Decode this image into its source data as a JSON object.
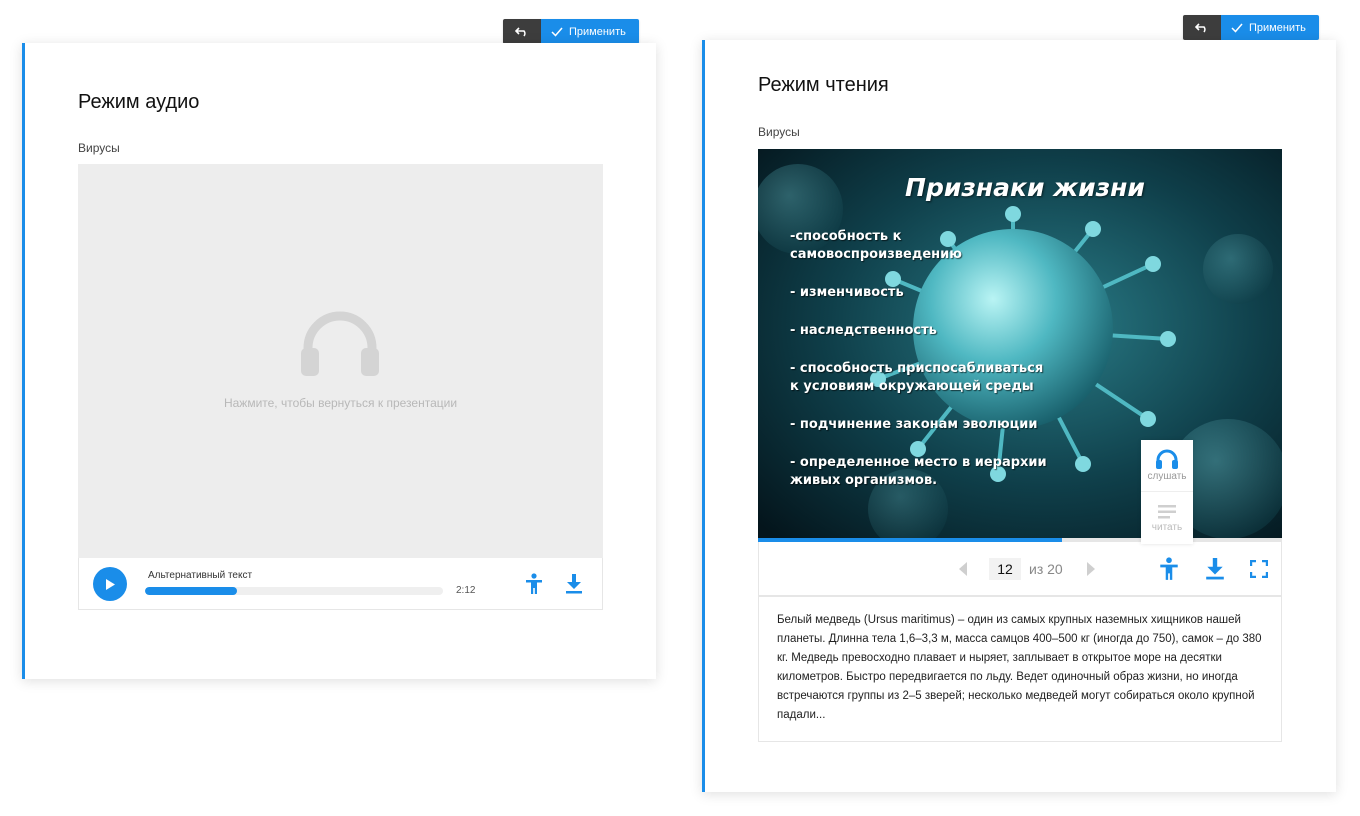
{
  "audio_card": {
    "toolbar": {
      "undo_icon": "undo-icon",
      "apply_label": "Применить"
    },
    "title": "Режим аудио",
    "subtitle": "Вирусы",
    "hint": "Нажмите, чтобы вернуться к презентации",
    "player": {
      "alt_text": "Альтернативный текст",
      "time": "2:12",
      "progress": 0.31
    }
  },
  "reading_card": {
    "toolbar": {
      "undo_icon": "undo-icon",
      "apply_label": "Применить"
    },
    "title": "Режим чтения",
    "subtitle": "Вирусы",
    "slide": {
      "title": "Признаки жизни",
      "bullets": [
        "-способность к самовоспроизведению",
        "- изменчивость",
        "- наследственность",
        "- способность приспосабливаться к условиям окружающей среды",
        "- подчинение законам эволюции",
        "- определенное место в иерархии живых организмов."
      ]
    },
    "modes": {
      "listen": "слушать",
      "read": "читать"
    },
    "pager": {
      "current": "12",
      "of_label": "из 20"
    },
    "slide_progress": 0.58,
    "description": "Белый медведь (Ursus maritimus) – один из самых крупных наземных хищников нашей планеты. Длинна тела 1,6–3,3 м, масса самцов 400–500 кг (иногда до 750), самок – до 380 кг. Медведь превосходно плавает и ныряет, заплывает в открытое море на десятки километров. Быстро передвигается по льду. Ведет одиночный образ жизни, но иногда встречаются группы из 2–5 зверей; несколько медведей могут собираться около крупной падали..."
  },
  "colors": {
    "accent": "#1a8de9",
    "dark": "#3d3d3d",
    "placeholder": "#ededed"
  }
}
